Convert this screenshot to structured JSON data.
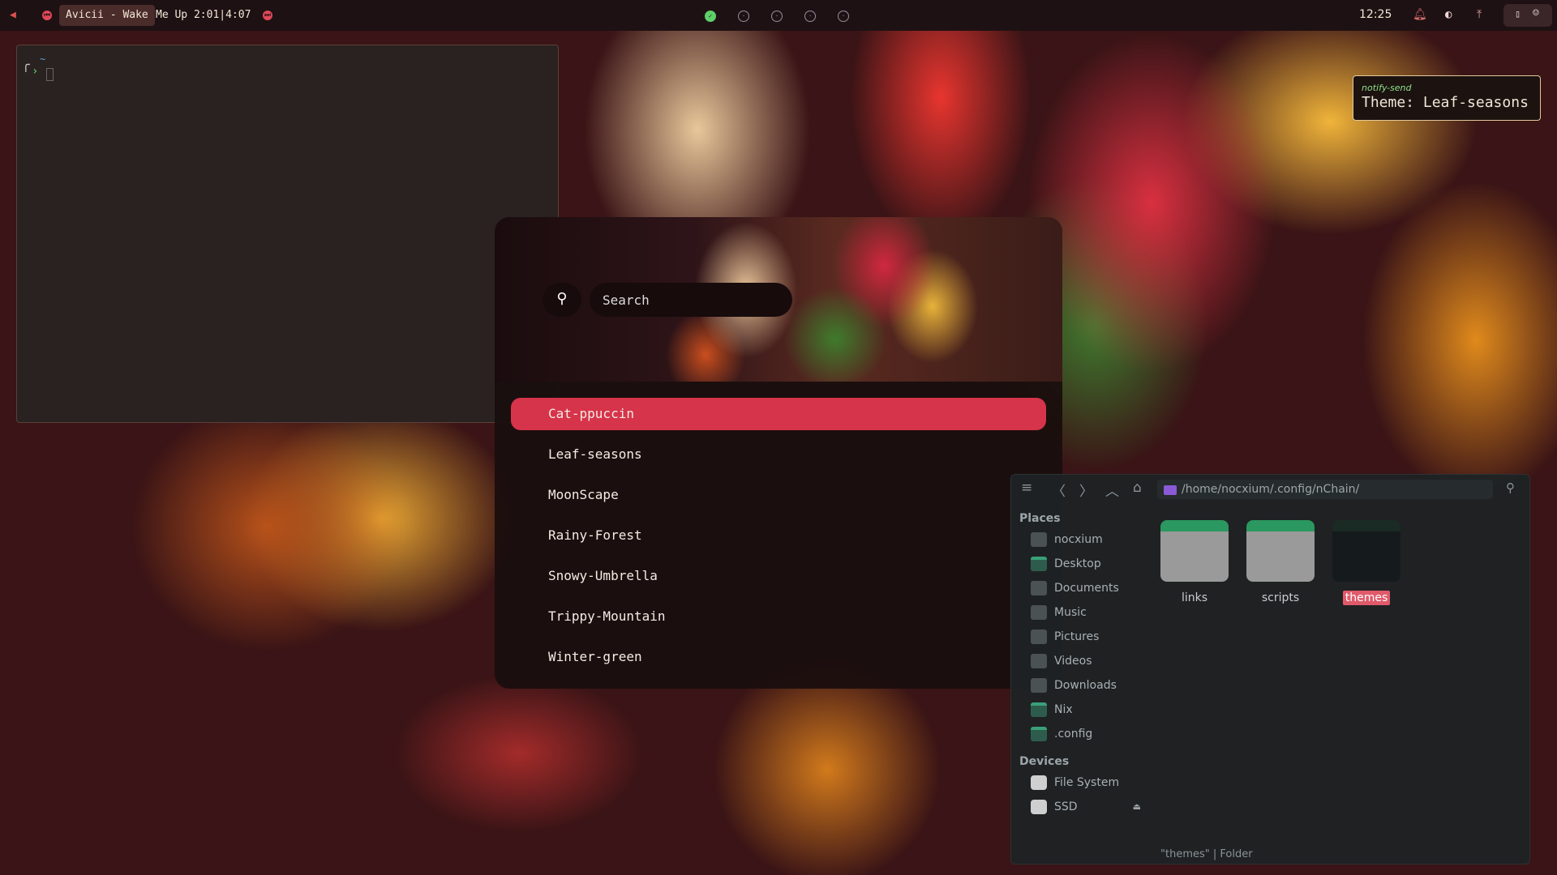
{
  "topbar": {
    "media_title": "Avicii - Wake",
    "media_rest": "Me Up 2:01|4:07",
    "clock": "12:25",
    "workspaces": [
      "1",
      "2",
      "3",
      "4",
      "5"
    ]
  },
  "terminal": {
    "prompt_tilde": "~"
  },
  "notification": {
    "app": "notify-send",
    "body": "Theme: Leaf-seasons"
  },
  "launcher": {
    "search_placeholder": "Search",
    "items": [
      "Cat-ppuccin",
      "Leaf-seasons",
      "MoonScape",
      "Rainy-Forest",
      "Snowy-Umbrella",
      "Trippy-Mountain",
      "Winter-green"
    ],
    "selected_index": 0
  },
  "file_manager": {
    "path": "/home/nocxium/.config/nChain/",
    "places_heading": "Places",
    "places": [
      "nocxium",
      "Desktop",
      "Documents",
      "Music",
      "Pictures",
      "Videos",
      "Downloads",
      "Nix",
      ".config"
    ],
    "devices_heading": "Devices",
    "devices": [
      "File System",
      "SSD"
    ],
    "items": [
      "links",
      "scripts",
      "themes"
    ],
    "selected_item": "themes",
    "status_name": "\"themes\"",
    "status_sep": "|",
    "status_type": "Folder"
  },
  "colors": {
    "accent": "#d6344a",
    "workspace_active": "#5fd068",
    "notify_border": "#e2c99c",
    "folder_tab": "#2a9860"
  }
}
